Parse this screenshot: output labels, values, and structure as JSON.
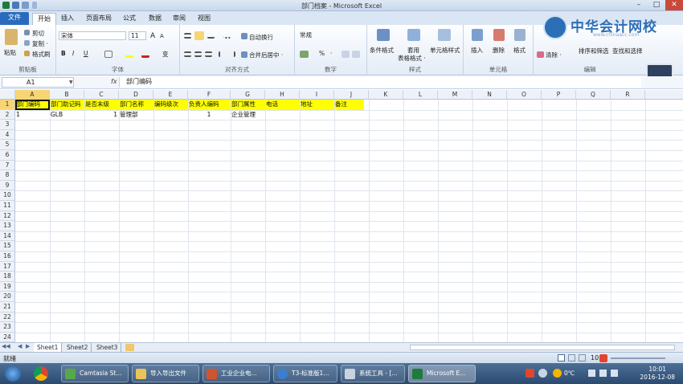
{
  "window": {
    "title": "部门档案 - Microsoft Excel"
  },
  "tabs": [
    "文件",
    "开始",
    "插入",
    "页面布局",
    "公式",
    "数据",
    "审阅",
    "视图"
  ],
  "ribbon": {
    "clipboard": {
      "paste": "粘贴",
      "cut": "剪切",
      "copy": "复制 ·",
      "format_painter": "格式刷",
      "label": "剪贴板"
    },
    "font": {
      "name": "宋体",
      "size": "11",
      "label": "字体",
      "grow": "A",
      "shrink": "A",
      "bold": "B",
      "italic": "I",
      "underline": "U",
      "wen": "变"
    },
    "alignment": {
      "wrap": "自动换行",
      "merge": "合并后居中 ·",
      "label": "对齐方式"
    },
    "number": {
      "format": "常规",
      "percent": "%",
      "comma": "·",
      "label": "数字"
    },
    "styles": {
      "conditional": "条件格式",
      "table": "套用",
      "table2": "表格格式 ·",
      "cell": "单元格样式",
      "label": "样式"
    },
    "cells": {
      "insert": "插入",
      "delete": "删除",
      "format": "格式",
      "label": "单元格"
    },
    "editing": {
      "clear": "清除 ·",
      "sort": "排序和筛选",
      "find": "查找和选择",
      "label": "编辑"
    }
  },
  "watermark": {
    "text": "中华会计网校",
    "sub": "www.chinaacc.com"
  },
  "namebox": "A1",
  "fx": "fx",
  "formula": "部门编码",
  "columns": [
    "A",
    "B",
    "C",
    "D",
    "E",
    "F",
    "G",
    "H",
    "I",
    "J",
    "K",
    "L",
    "M",
    "N",
    "O",
    "P",
    "Q",
    "R"
  ],
  "rows": [
    "1",
    "2",
    "3",
    "4",
    "5",
    "6",
    "7",
    "8",
    "9",
    "10",
    "11",
    "12",
    "13",
    "14",
    "15",
    "16",
    "17",
    "18",
    "19",
    "20",
    "21",
    "22",
    "23",
    "24"
  ],
  "cells": {
    "a1": "部门编码",
    "b1": "部门助记码",
    "c1": "是否末级",
    "d1": "部门名称",
    "e1": "编码级次",
    "f1": "负责人编码",
    "g1": "部门属性",
    "h1": "电话",
    "i1": "地址",
    "j1": "备注",
    "a2": "1",
    "b2": "GLB",
    "c2": "1",
    "d2": "管理部",
    "f2": "1",
    "g2": "企业管理"
  },
  "sheets": [
    "Sheet1",
    "Sheet2",
    "Sheet3"
  ],
  "status": {
    "ready": "就绪",
    "zoom": "10"
  },
  "taskbar": {
    "items": [
      "Camtasia St...",
      "导入导出文件",
      "工业企业电...",
      "T3-标准版1...",
      "系统工具 - [...",
      "Microsoft E..."
    ],
    "time": "10:01",
    "date": "2016-12-08",
    "temp": "0℃"
  }
}
